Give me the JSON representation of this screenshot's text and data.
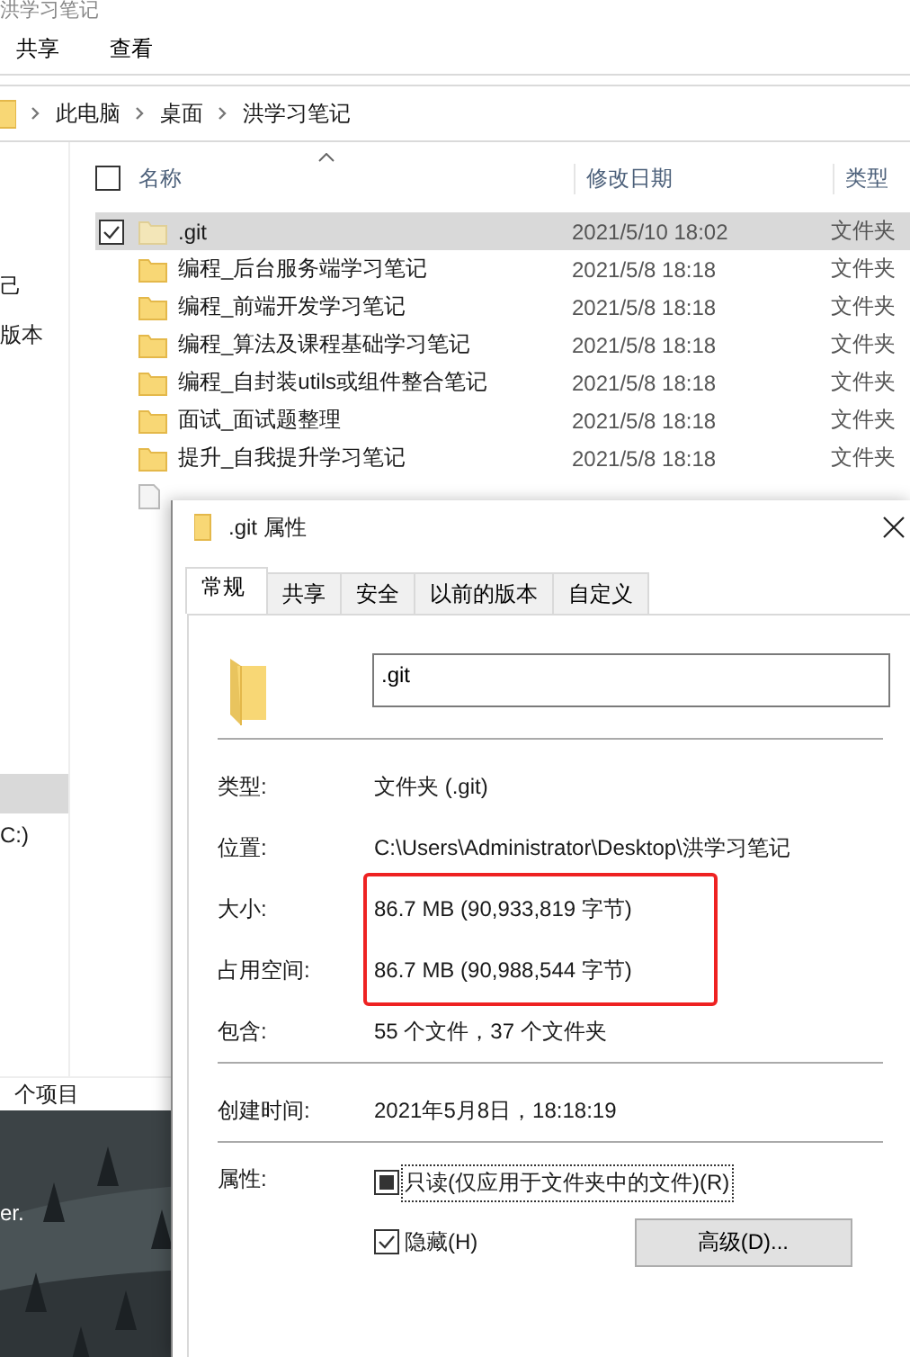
{
  "explorer": {
    "title": "洪学习笔记",
    "ribbon_tabs": [
      {
        "label": "共享"
      },
      {
        "label": "查看"
      }
    ],
    "breadcrumb": [
      "此电脑",
      "桌面",
      "洪学习笔记"
    ],
    "nav_items": [
      {
        "label": "己",
        "selected": false
      },
      {
        "label": "版本",
        "selected": false
      },
      {
        "selected": true
      },
      {
        "label": "C:)",
        "selected": false
      }
    ],
    "select_all_checked": false,
    "columns": [
      "名称",
      "修改日期",
      "类型"
    ],
    "rows": [
      {
        "name": ".git",
        "modified": "2021/5/10 18:02",
        "type": "文件夹",
        "selected": true,
        "hidden": true
      },
      {
        "name": "编程_后台服务端学习笔记",
        "modified": "2021/5/8 18:18",
        "type": "文件夹",
        "selected": false,
        "hidden": false
      },
      {
        "name": "编程_前端开发学习笔记",
        "modified": "2021/5/8 18:18",
        "type": "文件夹",
        "selected": false,
        "hidden": false
      },
      {
        "name": "编程_算法及课程基础学习笔记",
        "modified": "2021/5/8 18:18",
        "type": "文件夹",
        "selected": false,
        "hidden": false
      },
      {
        "name": "编程_自封装utils或组件整合笔记",
        "modified": "2021/5/8 18:18",
        "type": "文件夹",
        "selected": false,
        "hidden": false
      },
      {
        "name": "面试_面试题整理",
        "modified": "2021/5/8 18:18",
        "type": "文件夹",
        "selected": false,
        "hidden": false
      },
      {
        "name": "提升_自我提升学习笔记",
        "modified": "2021/5/8 18:18",
        "type": "文件夹",
        "selected": false,
        "hidden": false
      }
    ],
    "status_bar": "个项目"
  },
  "desktop": {
    "kind": "picture",
    "caption": "er."
  },
  "dialog": {
    "title": ".git 属性",
    "tabs": [
      {
        "label": "常规",
        "selected": true
      },
      {
        "label": "共享",
        "selected": false
      },
      {
        "label": "安全",
        "selected": false
      },
      {
        "label": "以前的版本",
        "selected": false
      },
      {
        "label": "自定义",
        "selected": false
      }
    ],
    "name_value": ".git",
    "sections": [
      [
        {
          "label": "类型:",
          "value": "文件夹 (.git)",
          "highlighted": false
        },
        {
          "label": "位置:",
          "value": "C:\\Users\\Administrator\\Desktop\\洪学习笔记",
          "highlighted": false
        },
        {
          "label": "大小:",
          "value": "86.7 MB (90,933,819 字节)",
          "highlighted": true
        },
        {
          "label": "占用空间:",
          "value": "86.7 MB (90,988,544 字节)",
          "highlighted": true
        },
        {
          "label": "包含:",
          "value": "55 个文件，37 个文件夹",
          "highlighted": false
        }
      ],
      [
        {
          "label": "创建时间:",
          "value": "2021年5月8日，18:18:19",
          "highlighted": false
        }
      ]
    ],
    "attributes_label": "属性:",
    "attributes": [
      {
        "label": "只读(仅应用于文件夹中的文件)(R)",
        "checked": false,
        "mixed": true,
        "focused": true
      },
      {
        "label": "隐藏(H)",
        "checked": true,
        "mixed": false,
        "focused": false
      }
    ],
    "advanced_button": "高级(D)..."
  }
}
